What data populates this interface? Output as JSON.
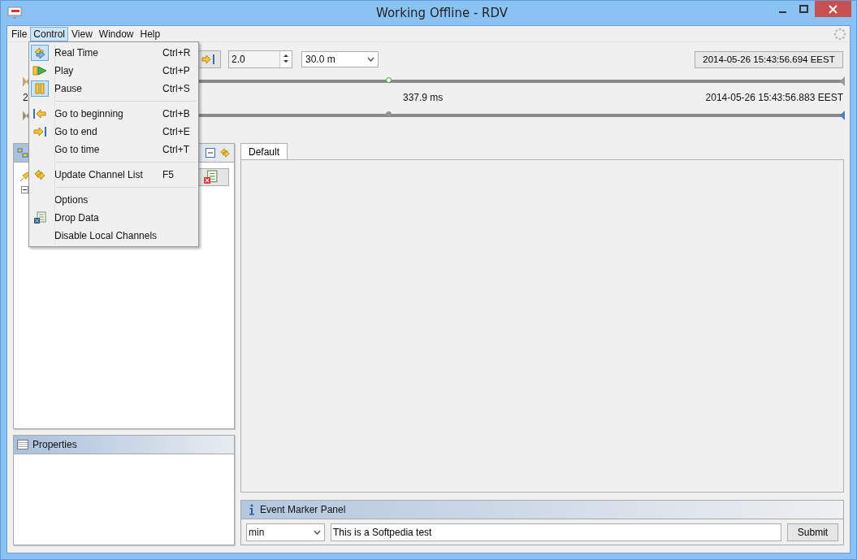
{
  "window": {
    "title": "Working Offline - RDV"
  },
  "menubar": [
    {
      "label": "File",
      "selected": false
    },
    {
      "label": "Control",
      "selected": true
    },
    {
      "label": "View",
      "selected": false
    },
    {
      "label": "Window",
      "selected": false
    },
    {
      "label": "Help",
      "selected": false
    }
  ],
  "menu": [
    {
      "kind": "item",
      "label": "Real Time",
      "shortcut": "Ctrl+R",
      "checked": true
    },
    {
      "kind": "item",
      "label": "Play",
      "shortcut": "Ctrl+P",
      "checked": false
    },
    {
      "kind": "item",
      "label": "Pause",
      "shortcut": "Ctrl+S",
      "checked": true
    },
    {
      "kind": "separator"
    },
    {
      "kind": "item",
      "label": "Go to beginning",
      "shortcut": "Ctrl+B",
      "checked": false
    },
    {
      "kind": "item",
      "label": "Go to end",
      "shortcut": "Ctrl+E",
      "checked": false
    },
    {
      "kind": "item",
      "label": "Go to time",
      "shortcut": "Ctrl+T",
      "checked": false
    },
    {
      "kind": "separator"
    },
    {
      "kind": "item",
      "label": "Update Channel List",
      "shortcut": "F5",
      "checked": false
    },
    {
      "kind": "separator"
    },
    {
      "kind": "item",
      "label": "Options",
      "checked": false
    },
    {
      "kind": "item",
      "label": "Drop Data",
      "checked": false
    },
    {
      "kind": "item",
      "label": "Disable Local Channels",
      "checked": false
    }
  ],
  "toolbar": {
    "rate": "2.0",
    "span": "30.0 m",
    "current_time": "2014-05-26 15:43:56.694 EEST"
  },
  "timeline": {
    "start_label": "2",
    "duration": "337.9 ms",
    "end_time": "2014-05-26 15:43:56.883 EEST"
  },
  "sliders": [
    {
      "level": 0.44
    },
    {
      "level": 0.44
    }
  ],
  "properties": {
    "title": "Properties"
  },
  "tabs": [
    {
      "label": "Default",
      "selected": true
    }
  ],
  "event_marker": {
    "title": "Event Marker Panel",
    "unit": "min",
    "text": "This is a Softpedia test",
    "button": "Submit"
  }
}
